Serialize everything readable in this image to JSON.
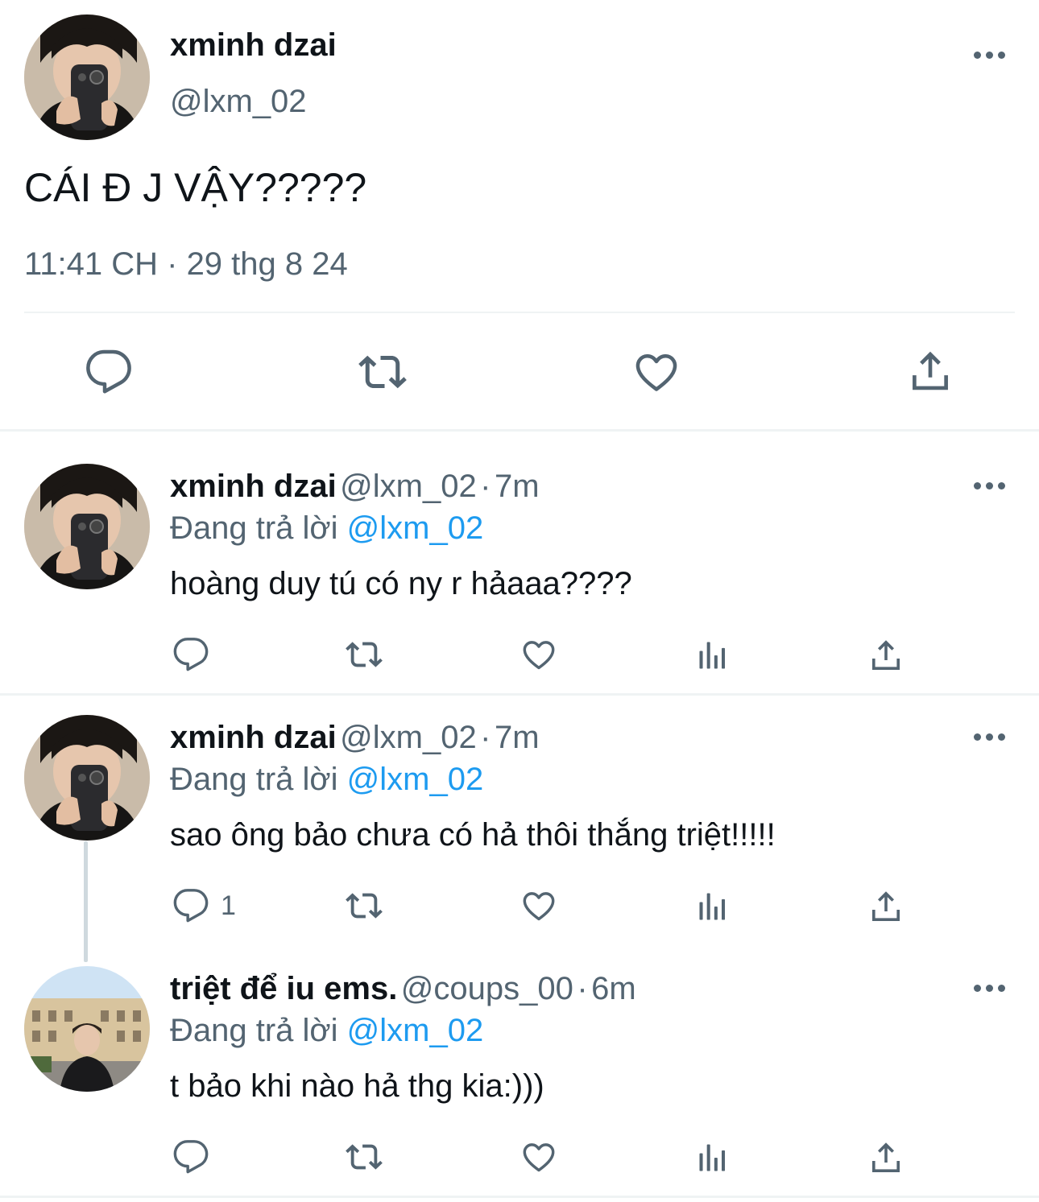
{
  "main_tweet": {
    "name": "xminh dzai",
    "handle": "@lxm_02",
    "text": "CÁI Đ J VẬY?????",
    "timestamp": "11:41 CH · 29 thg 8 24"
  },
  "replies": [
    {
      "name": "xminh dzai",
      "handle": "@lxm_02",
      "time": "7m",
      "replying_label": "Đang trả lời",
      "replying_to": "@lxm_02",
      "text": "hoàng duy tú có ny r hảaaa????",
      "reply_count": ""
    },
    {
      "name": "xminh dzai",
      "handle": "@lxm_02",
      "time": "7m",
      "replying_label": "Đang trả lời",
      "replying_to": "@lxm_02",
      "text": "sao ông bảo chưa có hả thôi thắng triệt!!!!!",
      "reply_count": "1"
    },
    {
      "name": "triệt để iu ems.",
      "handle": "@coups_00",
      "time": "6m",
      "replying_label": "Đang trả lời",
      "replying_to": "@lxm_02",
      "text": "t bảo khi nào hả thg kia:)))",
      "reply_count": ""
    }
  ],
  "separator": "·",
  "icons": [
    "reply-icon",
    "retweet-icon",
    "like-icon",
    "views-icon",
    "share-icon",
    "more-icon"
  ],
  "colors": {
    "text": "#0f1419",
    "muted": "#536471",
    "link": "#1d9bf0",
    "divider": "#eff3f4"
  }
}
